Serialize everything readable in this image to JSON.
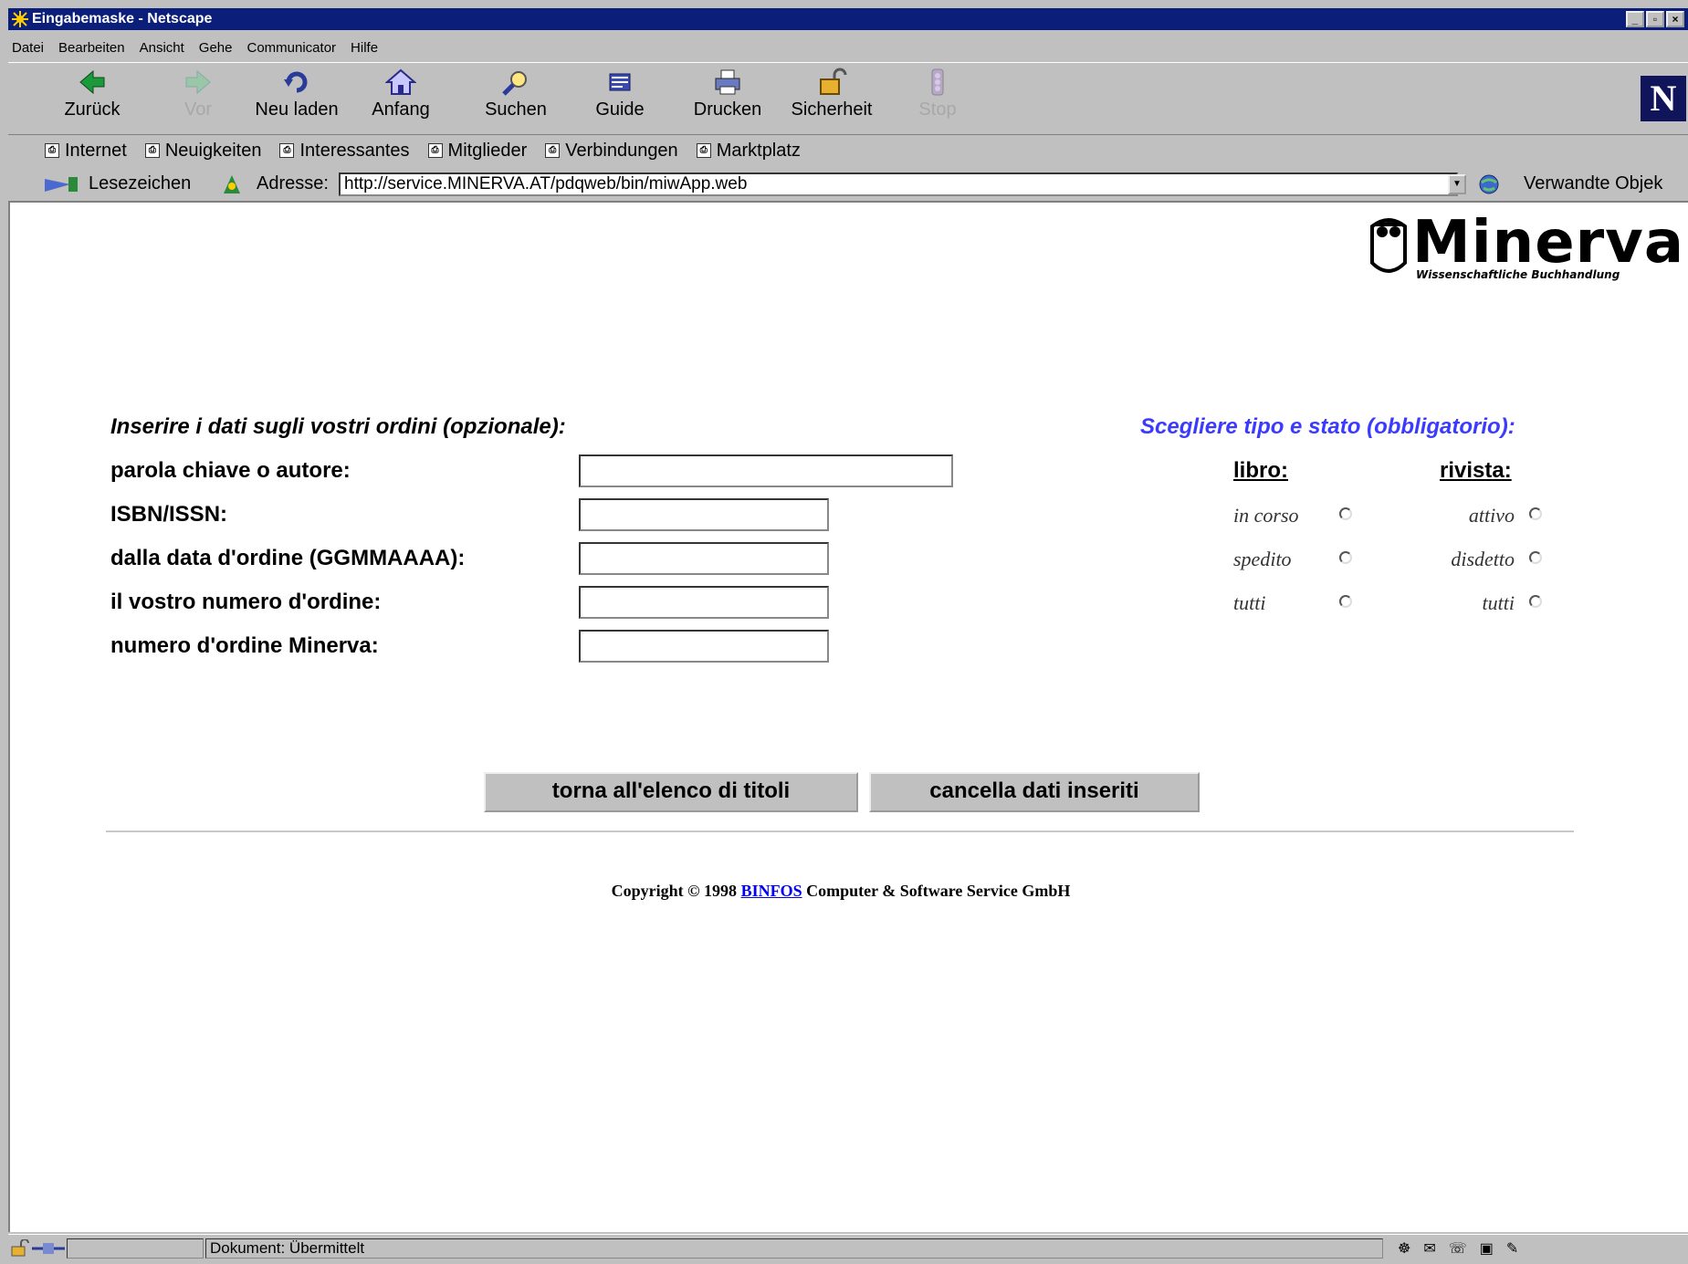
{
  "window": {
    "title": "Eingabemaske - Netscape",
    "controls": {
      "minimize": "_",
      "maximize": "▫",
      "close": "×"
    }
  },
  "menu": [
    "Datei",
    "Bearbeiten",
    "Ansicht",
    "Gehe",
    "Communicator",
    "Hilfe"
  ],
  "toolbar": {
    "back": "Zurück",
    "forward": "Vor",
    "reload": "Neu laden",
    "home": "Anfang",
    "search": "Suchen",
    "guide": "Guide",
    "print": "Drucken",
    "security": "Sicherheit",
    "stop": "Stop",
    "logo": "N"
  },
  "personal_toolbar": [
    "Internet",
    "Neuigkeiten",
    "Interessantes",
    "Mitglieder",
    "Verbindungen",
    "Marktplatz"
  ],
  "location": {
    "bookmarks": "Lesezeichen",
    "address_label": "Adresse:",
    "url": "http://service.MINERVA.AT/pdqweb/bin/miwApp.web",
    "related": "Verwandte Objek"
  },
  "page": {
    "logo_text": "Minerva",
    "logo_sub": "Wissenschaftliche Buchhandlung",
    "left_heading": "Inserire i dati sugli vostri ordini (opzionale):",
    "right_heading": "Scegliere tipo e stato (obbligatorio):",
    "fields": [
      {
        "label": "parola chiave o autore:",
        "value": ""
      },
      {
        "label": "ISBN/ISSN:",
        "value": ""
      },
      {
        "label": "dalla data d'ordine (GGMMAAAA):",
        "value": ""
      },
      {
        "label": "il vostro numero d'ordine:",
        "value": ""
      },
      {
        "label": "numero d'ordine Minerva:",
        "value": ""
      }
    ],
    "libro": {
      "header": "libro:",
      "options": [
        "in corso",
        "spedito",
        "tutti"
      ]
    },
    "rivista": {
      "header": "rivista:",
      "options": [
        "attivo",
        "disdetto",
        "tutti"
      ]
    },
    "buttons": {
      "back_to_list": "torna all'elenco di titoli",
      "clear": "cancella dati inseriti"
    },
    "copyright_prefix": "Copyright © 1998",
    "copyright_link": "BINFOS",
    "copyright_suffix": "Computer & Software Service GmbH"
  },
  "status": {
    "text": "Dokument: Übermittelt"
  }
}
